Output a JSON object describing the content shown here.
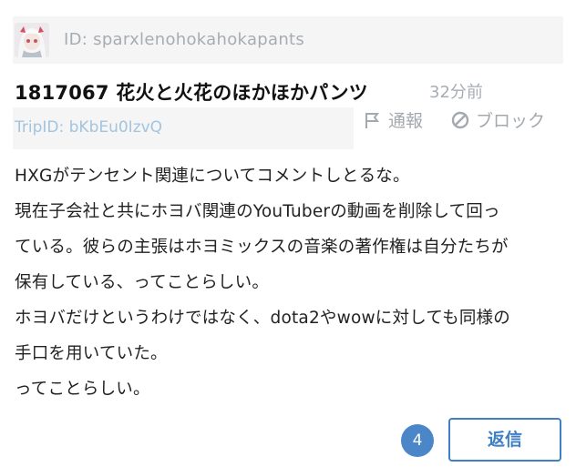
{
  "post": {
    "user_id": "ID: sparxlenohokahokapants",
    "title": "1817067 花火と火花のほかほかパンツ",
    "time_ago": "32分前",
    "trip_id": "TripID: bKbEu0IzvQ",
    "actions": {
      "report_label": "通報",
      "block_label": "ブロック",
      "report_icon": "flag-icon",
      "block_icon": "block-icon"
    },
    "body_lines": [
      "HXGがテンセント関連についてコメントしとるな。",
      "現在子会社と共にホヨバ関連のYouTuberの動画を削除して回っ",
      "ている。彼らの主張はホヨミックスの音楽の著作権は自分たちが",
      "保有している、ってことらしい。",
      "ホヨバだけというわけではなく、dota2やwowに対しても同様の",
      "手口を用いていた。",
      "ってことらしい。"
    ],
    "reply_count": "4",
    "reply_label": "返信"
  },
  "colors": {
    "accent": "#3f7fc4",
    "badge": "#4a86c8",
    "muted": "#a7acb3",
    "trip": "#a3c4de",
    "panel": "#f5f5f5"
  }
}
